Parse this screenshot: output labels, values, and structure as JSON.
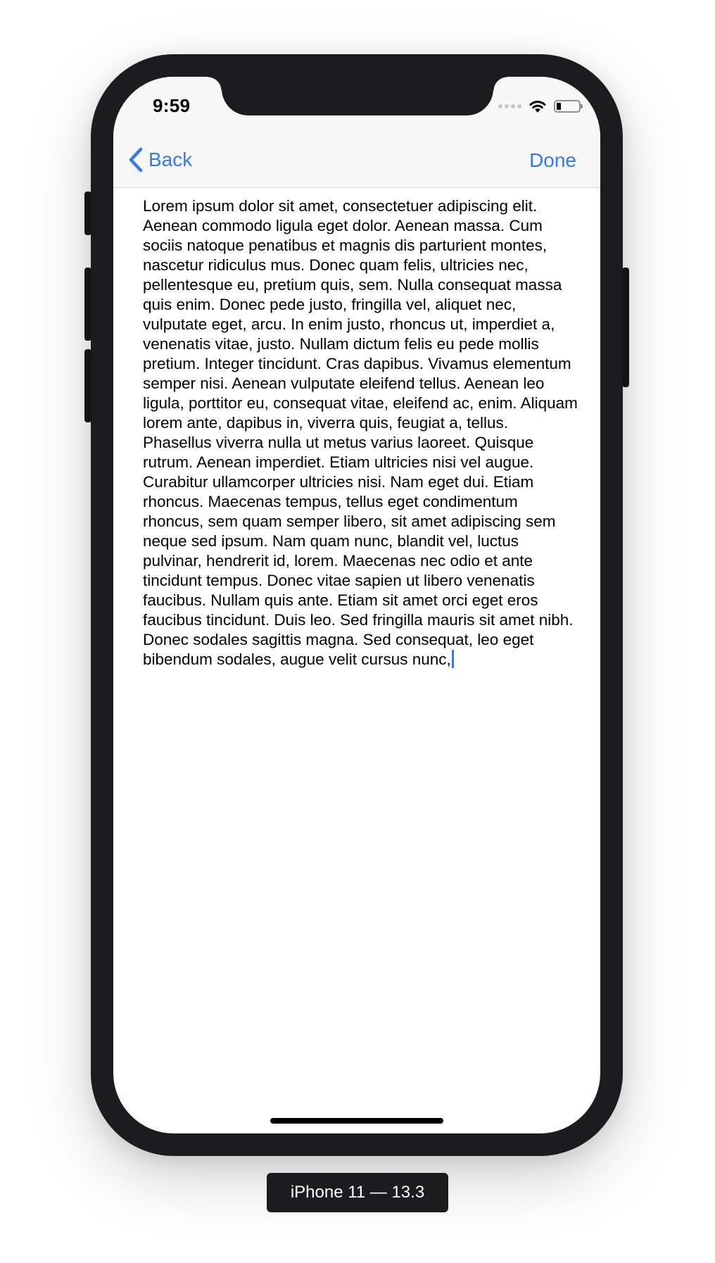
{
  "status_bar": {
    "time": "9:59",
    "icons": [
      "cellular-signal-icon",
      "wifi-icon",
      "battery-icon"
    ],
    "battery_level": 0.2
  },
  "nav_bar": {
    "back_label": "Back",
    "done_label": "Done",
    "tint_color": "#3478f6"
  },
  "text_view": {
    "content": "Lorem ipsum dolor sit amet, consectetuer adipiscing elit. Aenean commodo ligula eget dolor. Aenean massa. Cum sociis natoque penatibus et magnis dis parturient montes, nascetur ridiculus mus. Donec quam felis, ultricies nec, pellentesque eu, pretium quis, sem. Nulla consequat massa quis enim. Donec pede justo, fringilla vel, aliquet nec, vulputate eget, arcu. In enim justo, rhoncus ut, imperdiet a, venenatis vitae, justo. Nullam dictum felis eu pede mollis pretium. Integer tincidunt. Cras dapibus. Vivamus elementum semper nisi. Aenean vulputate eleifend tellus. Aenean leo ligula, porttitor eu, consequat vitae, eleifend ac, enim. Aliquam lorem ante, dapibus in, viverra quis, feugiat a, tellus. Phasellus viverra nulla ut metus varius laoreet. Quisque rutrum. Aenean imperdiet. Etiam ultricies nisi vel augue. Curabitur ullamcorper ultricies nisi. Nam eget dui. Etiam rhoncus. Maecenas tempus, tellus eget condimentum rhoncus, sem quam semper libero, sit amet adipiscing sem neque sed ipsum. Nam quam nunc, blandit vel, luctus pulvinar, hendrerit id, lorem. Maecenas nec odio et ante tincidunt tempus. Donec vitae sapien ut libero venenatis faucibus. Nullam quis ante. Etiam sit amet orci eget eros faucibus tincidunt. Duis leo. Sed fringilla mauris sit amet nibh. Donec sodales sagittis magna. Sed consequat, leo eget bibendum sodales, augue velit cursus nunc,"
  },
  "simulator": {
    "device_label": "iPhone 11 — 13.3"
  }
}
